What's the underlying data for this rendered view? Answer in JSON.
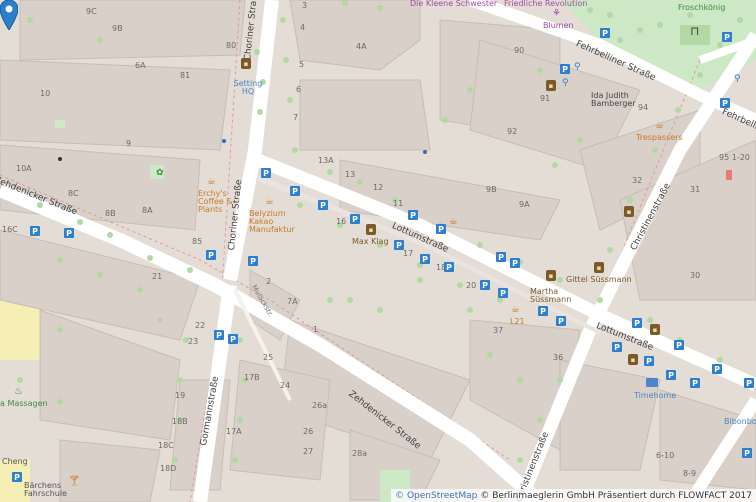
{
  "map": {
    "streets": {
      "choriner_north": "Choriner Straße",
      "choriner_south": "Choriner Straße",
      "zehdenicker_west": "Zehdenicker Straße",
      "zehdenicker_east": "Zehdenicker Straße",
      "lottumstrasse_mid": "Lottumstraße",
      "lottumstrasse_east": "Lottumstraße",
      "christinenstrasse_north": "Christinenstraße",
      "christinenstrasse_south": "Christinenstraße",
      "fehrbelliner_mid": "Fehrbelliner Straße",
      "fehrbelliner_east": "Fehrbelliner",
      "gormannstrasse": "Gormannstraße",
      "mulackstrasse": "Mulackstr."
    },
    "pois": {
      "die_kleene_schwester": "Die Kleene Schwester",
      "fredliche_revolution": "Friedliche Revolution",
      "blumen": "Blumen",
      "froschkoenig": "Froschkönig",
      "setting_hq": "Setting HQ",
      "ida_judith": "Ida Judith Bamberger",
      "trespassers": "Trespassers",
      "erchys_coffee": "Erchy's Coffee & Plants",
      "belyzium": "Belyzium Kakao Manufaktur",
      "max_klag": "Max Klag",
      "gittel_sussmann": "Gittel Süssmann",
      "martha_sussmann": "Martha Süssmann",
      "l21": "L21",
      "timehome": "Timehome",
      "bibonbo": "Bibonbo",
      "massagen": "a Massagen",
      "cheng": "Cheng",
      "barchens": "Bärchens Fahrschule"
    },
    "house_numbers": {
      "n9c": "9C",
      "n9b": "9B",
      "n80": "80",
      "n81": "81",
      "n6a": "6A",
      "n10": "10",
      "n9": "9",
      "n10a": "10A",
      "n8c": "8C",
      "n8b": "8B",
      "n8a": "8A",
      "n85": "85",
      "n16c": "16C",
      "n3": "3",
      "n4": "4",
      "n4a": "4A",
      "n5": "5",
      "n6": "6",
      "n7": "7",
      "n13": "13",
      "n13a": "13A",
      "n12": "12",
      "n11": "11",
      "n16": "16",
      "n17": "17",
      "n18": "18",
      "n9b2": "9B",
      "n9a": "9A",
      "n20": "20",
      "n37": "37",
      "n36": "36",
      "n90": "90",
      "n91": "91",
      "n92": "92",
      "n94": "94",
      "n95": "95 1-20",
      "n32": "32",
      "n31": "31",
      "n30": "30",
      "n7a": "7A",
      "n1": "1",
      "n2": "2",
      "n21": "21",
      "n22": "22",
      "n23": "23",
      "n24": "24",
      "n25": "25",
      "n26a": "26a",
      "n26": "26",
      "n27": "27",
      "n28a": "28a",
      "n17b": "17B",
      "n17a": "17A",
      "n18b": "18B",
      "n18c": "18C",
      "n18d": "18D",
      "n19": "19",
      "n6_10": "6-10",
      "n8_9": "8-9"
    },
    "attribution": {
      "osm": "© OpenStreetMap",
      "credit": "© Berlinmaeglerin GmbH Präsentiert durch FLOWFACT 2017"
    },
    "colors": {
      "building": "#d9d0c9",
      "building_edge": "#c8bdb4",
      "road": "#ffffff",
      "park": "#cde8c4",
      "yellow_block": "#f5efb6",
      "tree": "#b2d8a4",
      "parking": "#2d7fd0",
      "marker": "#2a81cb"
    }
  }
}
